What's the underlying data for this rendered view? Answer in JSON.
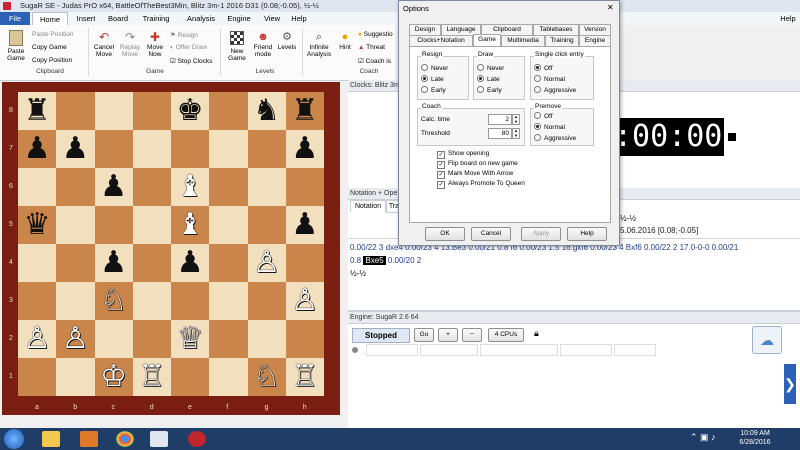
{
  "window": {
    "title": "SugaR SE - Judas PrO x64, BattleOfTheBest3Min, Blitz 3m-1 2016  D31  (0.08;-0.05), ½-½"
  },
  "ribbon": {
    "tabs": [
      "File",
      "Home",
      "Insert",
      "Board",
      "Training",
      "Analysis",
      "Engine",
      "View",
      "Help"
    ],
    "help_label": "Help",
    "paste_game": "Paste Game",
    "paste_position": "Paste Position",
    "copy_game": "Copy Game",
    "copy_position": "Copy Position",
    "cancel_move": "Cancel Move",
    "replay_move": "Replay Move",
    "move_now": "Move Now",
    "resign": "Resign",
    "offer_draw": "Offer Draw",
    "stop_clocks": "Stop Clocks",
    "new_game": "New Game",
    "friend_mode": "Friend mode",
    "levels": "Levels",
    "infinite_analysis": "Infinite Analysis",
    "hint": "Hint",
    "suggestion": "Suggestio",
    "threat": "Threat",
    "coach": "Coach is",
    "groups": {
      "clipboard": "Clipboard",
      "game": "Game",
      "levels": "Levels",
      "coach": "Coach"
    }
  },
  "board": {
    "files": [
      "a",
      "b",
      "c",
      "d",
      "e",
      "f",
      "g",
      "h"
    ],
    "ranks": [
      "8",
      "7",
      "6",
      "5",
      "4",
      "3",
      "2",
      "1"
    ],
    "pieces": [
      {
        "sq": "a8",
        "p": "♜",
        "c": "b"
      },
      {
        "sq": "e8",
        "p": "♚",
        "c": "b"
      },
      {
        "sq": "g8",
        "p": "♞",
        "c": "b"
      },
      {
        "sq": "h8",
        "p": "♜",
        "c": "b"
      },
      {
        "sq": "a7",
        "p": "♟",
        "c": "b"
      },
      {
        "sq": "b7",
        "p": "♟",
        "c": "b"
      },
      {
        "sq": "h7",
        "p": "♟",
        "c": "b"
      },
      {
        "sq": "c6",
        "p": "♟",
        "c": "b"
      },
      {
        "sq": "e6",
        "p": "♝",
        "c": "w"
      },
      {
        "sq": "a5",
        "p": "♛",
        "c": "b"
      },
      {
        "sq": "e5",
        "p": "♝",
        "c": "w"
      },
      {
        "sq": "h5",
        "p": "♟",
        "c": "b"
      },
      {
        "sq": "c4",
        "p": "♟",
        "c": "b"
      },
      {
        "sq": "e4",
        "p": "♟",
        "c": "b"
      },
      {
        "sq": "g4",
        "p": "♙",
        "c": "w"
      },
      {
        "sq": "c3",
        "p": "♘",
        "c": "w"
      },
      {
        "sq": "h3",
        "p": "♙",
        "c": "w"
      },
      {
        "sq": "a2",
        "p": "♙",
        "c": "w"
      },
      {
        "sq": "b2",
        "p": "♙",
        "c": "w"
      },
      {
        "sq": "e2",
        "p": "♕",
        "c": "w"
      },
      {
        "sq": "c1",
        "p": "♔",
        "c": "w"
      },
      {
        "sq": "d1",
        "p": "♖",
        "c": "w"
      },
      {
        "sq": "g1",
        "p": "♘",
        "c": "w"
      },
      {
        "sq": "h1",
        "p": "♖",
        "c": "w"
      }
    ]
  },
  "clock": {
    "header": "Clocks: Blitz 3m",
    "time": ":00:00"
  },
  "notation": {
    "header": "Notation + Ope",
    "tab_notation": "Notation",
    "tab_other": "Tra",
    "result_top": "½-½",
    "date_eval": "5.06.2016 [0.08;-0.05]",
    "moves_line1_pre": "0.00/22 3  dxe4 0.00/23 4  13.Be3 0.00/21 0.8  f6 0.00/23 1.5  16.gxf6 0.00/23 4  Bxf6 0.00/22 2  17.0-0-0 0.00/21",
    "moves_line2_pre": "0.8",
    "current_move": "Bxe5",
    "moves_line2_post": "0.00/20 2",
    "result_bottom": "½-½"
  },
  "engine": {
    "header": "Engine: SugaR 2.6 64",
    "status": "Stopped",
    "go": "Go",
    "plus": "+",
    "minus": "−",
    "cpus": "4 CPUs"
  },
  "dialog": {
    "title": "Options",
    "tabs_row1": [
      "Design",
      "Language",
      "Clipboard",
      "Tablebases",
      "Version"
    ],
    "tabs_row2": [
      "Clocks+Notation",
      "Game",
      "Multimedia",
      "Training",
      "Engine"
    ],
    "resign": {
      "legend": "Resign",
      "options": [
        "Never",
        "Late",
        "Early"
      ],
      "selected": 1
    },
    "draw": {
      "legend": "Draw",
      "options": [
        "Never",
        "Late",
        "Early"
      ],
      "selected": 1
    },
    "single_click": {
      "legend": "Single click entry",
      "options": [
        "Off",
        "Normal",
        "Aggressive"
      ],
      "selected": 0
    },
    "coach": {
      "legend": "Coach",
      "calc_label": "Calc. time",
      "calc_value": "2",
      "threshold_label": "Threshold",
      "threshold_value": "80"
    },
    "premove": {
      "legend": "Premove",
      "options": [
        "Off",
        "Normal",
        "Aggressive"
      ],
      "selected": 1
    },
    "checks": [
      "Show opening",
      "Flip board on new game",
      "Mark Move With Arrow",
      "Always Promote To Queen"
    ],
    "buttons": {
      "ok": "OK",
      "cancel": "Cancel",
      "apply": "Apply",
      "help": "Help"
    }
  },
  "taskbar": {
    "time": "10:09 AM",
    "date": "6/28/2016"
  },
  "colors": {
    "accent": "#2b62b5",
    "board_dark": "#c9854a",
    "board_light": "#f2dfbe",
    "frame": "#7a1e12",
    "taskbar": "#1f3d66"
  }
}
